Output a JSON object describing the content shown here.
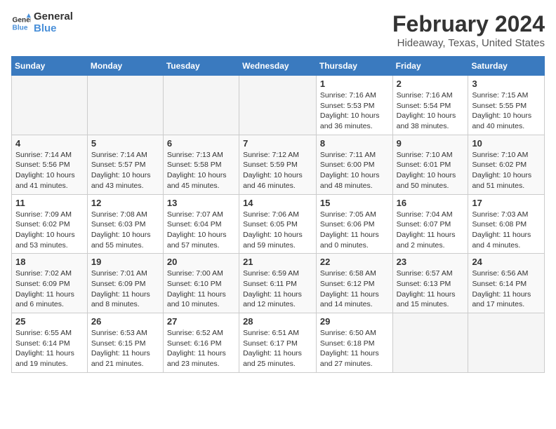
{
  "header": {
    "logo_line1": "General",
    "logo_line2": "Blue",
    "title": "February 2024",
    "subtitle": "Hideaway, Texas, United States"
  },
  "weekdays": [
    "Sunday",
    "Monday",
    "Tuesday",
    "Wednesday",
    "Thursday",
    "Friday",
    "Saturday"
  ],
  "weeks": [
    [
      {
        "day": "",
        "info": ""
      },
      {
        "day": "",
        "info": ""
      },
      {
        "day": "",
        "info": ""
      },
      {
        "day": "",
        "info": ""
      },
      {
        "day": "1",
        "info": "Sunrise: 7:16 AM\nSunset: 5:53 PM\nDaylight: 10 hours\nand 36 minutes."
      },
      {
        "day": "2",
        "info": "Sunrise: 7:16 AM\nSunset: 5:54 PM\nDaylight: 10 hours\nand 38 minutes."
      },
      {
        "day": "3",
        "info": "Sunrise: 7:15 AM\nSunset: 5:55 PM\nDaylight: 10 hours\nand 40 minutes."
      }
    ],
    [
      {
        "day": "4",
        "info": "Sunrise: 7:14 AM\nSunset: 5:56 PM\nDaylight: 10 hours\nand 41 minutes."
      },
      {
        "day": "5",
        "info": "Sunrise: 7:14 AM\nSunset: 5:57 PM\nDaylight: 10 hours\nand 43 minutes."
      },
      {
        "day": "6",
        "info": "Sunrise: 7:13 AM\nSunset: 5:58 PM\nDaylight: 10 hours\nand 45 minutes."
      },
      {
        "day": "7",
        "info": "Sunrise: 7:12 AM\nSunset: 5:59 PM\nDaylight: 10 hours\nand 46 minutes."
      },
      {
        "day": "8",
        "info": "Sunrise: 7:11 AM\nSunset: 6:00 PM\nDaylight: 10 hours\nand 48 minutes."
      },
      {
        "day": "9",
        "info": "Sunrise: 7:10 AM\nSunset: 6:01 PM\nDaylight: 10 hours\nand 50 minutes."
      },
      {
        "day": "10",
        "info": "Sunrise: 7:10 AM\nSunset: 6:02 PM\nDaylight: 10 hours\nand 51 minutes."
      }
    ],
    [
      {
        "day": "11",
        "info": "Sunrise: 7:09 AM\nSunset: 6:02 PM\nDaylight: 10 hours\nand 53 minutes."
      },
      {
        "day": "12",
        "info": "Sunrise: 7:08 AM\nSunset: 6:03 PM\nDaylight: 10 hours\nand 55 minutes."
      },
      {
        "day": "13",
        "info": "Sunrise: 7:07 AM\nSunset: 6:04 PM\nDaylight: 10 hours\nand 57 minutes."
      },
      {
        "day": "14",
        "info": "Sunrise: 7:06 AM\nSunset: 6:05 PM\nDaylight: 10 hours\nand 59 minutes."
      },
      {
        "day": "15",
        "info": "Sunrise: 7:05 AM\nSunset: 6:06 PM\nDaylight: 11 hours\nand 0 minutes."
      },
      {
        "day": "16",
        "info": "Sunrise: 7:04 AM\nSunset: 6:07 PM\nDaylight: 11 hours\nand 2 minutes."
      },
      {
        "day": "17",
        "info": "Sunrise: 7:03 AM\nSunset: 6:08 PM\nDaylight: 11 hours\nand 4 minutes."
      }
    ],
    [
      {
        "day": "18",
        "info": "Sunrise: 7:02 AM\nSunset: 6:09 PM\nDaylight: 11 hours\nand 6 minutes."
      },
      {
        "day": "19",
        "info": "Sunrise: 7:01 AM\nSunset: 6:09 PM\nDaylight: 11 hours\nand 8 minutes."
      },
      {
        "day": "20",
        "info": "Sunrise: 7:00 AM\nSunset: 6:10 PM\nDaylight: 11 hours\nand 10 minutes."
      },
      {
        "day": "21",
        "info": "Sunrise: 6:59 AM\nSunset: 6:11 PM\nDaylight: 11 hours\nand 12 minutes."
      },
      {
        "day": "22",
        "info": "Sunrise: 6:58 AM\nSunset: 6:12 PM\nDaylight: 11 hours\nand 14 minutes."
      },
      {
        "day": "23",
        "info": "Sunrise: 6:57 AM\nSunset: 6:13 PM\nDaylight: 11 hours\nand 15 minutes."
      },
      {
        "day": "24",
        "info": "Sunrise: 6:56 AM\nSunset: 6:14 PM\nDaylight: 11 hours\nand 17 minutes."
      }
    ],
    [
      {
        "day": "25",
        "info": "Sunrise: 6:55 AM\nSunset: 6:14 PM\nDaylight: 11 hours\nand 19 minutes."
      },
      {
        "day": "26",
        "info": "Sunrise: 6:53 AM\nSunset: 6:15 PM\nDaylight: 11 hours\nand 21 minutes."
      },
      {
        "day": "27",
        "info": "Sunrise: 6:52 AM\nSunset: 6:16 PM\nDaylight: 11 hours\nand 23 minutes."
      },
      {
        "day": "28",
        "info": "Sunrise: 6:51 AM\nSunset: 6:17 PM\nDaylight: 11 hours\nand 25 minutes."
      },
      {
        "day": "29",
        "info": "Sunrise: 6:50 AM\nSunset: 6:18 PM\nDaylight: 11 hours\nand 27 minutes."
      },
      {
        "day": "",
        "info": ""
      },
      {
        "day": "",
        "info": ""
      }
    ]
  ]
}
